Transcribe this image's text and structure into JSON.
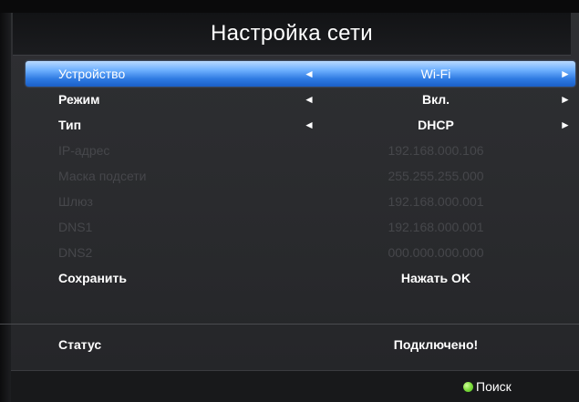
{
  "title": "Настройка сети",
  "rows": [
    {
      "label": "Устройство",
      "value": "Wi-Fi",
      "state": "selected",
      "arrows": true
    },
    {
      "label": "Режим",
      "value": "Вкл.",
      "state": "active",
      "arrows": true
    },
    {
      "label": "Тип",
      "value": "DHCP",
      "state": "active",
      "arrows": true
    },
    {
      "label": "IP-адрес",
      "value": "192.168.000.106",
      "state": "disabled",
      "arrows": false
    },
    {
      "label": "Маска подсети",
      "value": "255.255.255.000",
      "state": "disabled",
      "arrows": false
    },
    {
      "label": "Шлюз",
      "value": "192.168.000.001",
      "state": "disabled",
      "arrows": false
    },
    {
      "label": "DNS1",
      "value": "192.168.000.001",
      "state": "disabled",
      "arrows": false
    },
    {
      "label": "DNS2",
      "value": "000.000.000.000",
      "state": "disabled",
      "arrows": false
    },
    {
      "label": "Сохранить",
      "value": "Нажать OK",
      "state": "active",
      "arrows": false
    }
  ],
  "status": {
    "label": "Статус",
    "value": "Подключено!"
  },
  "footer": {
    "search_label": "Поиск",
    "search_color": "#7ddc3c"
  },
  "icons": {
    "arrow_left": "◄",
    "arrow_right": "►"
  },
  "colors": {
    "selection": "#2e7ae2",
    "disabled_text": "#46474b",
    "background": "#2a2b2e"
  }
}
